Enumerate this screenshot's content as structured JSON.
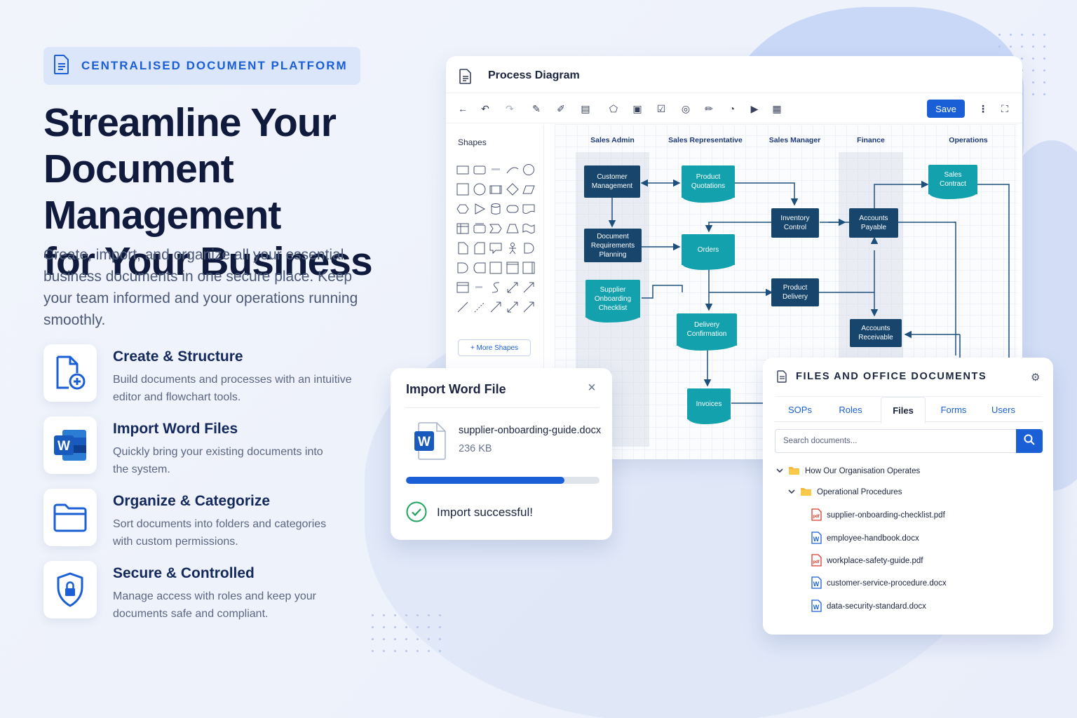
{
  "hero": {
    "badge": "CENTRALISED DOCUMENT PLATFORM",
    "headline_1": "Streamline Your",
    "headline_2": "Document Management",
    "headline_3": "for Your Business",
    "subtext": "Create, import, and organize all your essential business documents in one secure place. Keep your team informed and your operations running smoothly."
  },
  "features": [
    {
      "title": "Create & Structure",
      "desc": "Build documents and processes with an intuitive editor and flowchart tools.",
      "icon": "document-plus-icon"
    },
    {
      "title": "Import Word Files",
      "desc": "Quickly bring your existing documents into the system.",
      "icon": "word-icon"
    },
    {
      "title": "Organize & Categorize",
      "desc": "Sort documents into folders and categories with custom permissions.",
      "icon": "folder-icon"
    },
    {
      "title": "Secure & Controlled",
      "desc": "Manage access with roles and keep your documents safe and compliant.",
      "icon": "shield-lock-icon"
    }
  ],
  "diagram": {
    "title": "Process Diagram",
    "save_label": "Save",
    "shapes_title": "Shapes",
    "more_shapes": "+ More Shapes",
    "lanes": [
      "Sales Admin",
      "Sales Representative",
      "Sales Manager",
      "Finance",
      "Operations"
    ],
    "nodes": {
      "customer_management": "Customer Management",
      "product_quotations": "Product Quotations",
      "sales_contract": "Sales Contract",
      "inventory_control": "Inventory Control",
      "accounts_payable": "Accounts Payable",
      "document_requirements": "Document Requirements Planning",
      "orders": "Orders",
      "supplier_onboarding": "Supplier Onboarding Checklist",
      "product_delivery": "Product Delivery",
      "delivery_confirmation": "Delivery Confirmation",
      "accounts_receivable": "Accounts Receivable",
      "invoices": "Invoices"
    }
  },
  "import_dialog": {
    "title": "Import Word File",
    "file_name": "supplier-onboarding-guide.docx",
    "file_size": "236 KB",
    "progress": 0.82,
    "status": "Import successful!"
  },
  "files_panel": {
    "title": "FILES AND OFFICE DOCUMENTS",
    "tabs": [
      "SOPs",
      "Roles",
      "Files",
      "Forms",
      "Users"
    ],
    "active_tab": "Files",
    "search_placeholder": "Search documents...",
    "folder_1": "How Our Organisation Operates",
    "folder_2": "Operational Procedures",
    "files": [
      {
        "name": "supplier-onboarding-checklist.pdf",
        "type": "pdf"
      },
      {
        "name": "employee-handbook.docx",
        "type": "docx"
      },
      {
        "name": "workplace-safety-guide.pdf",
        "type": "pdf"
      },
      {
        "name": "customer-service-procedure.docx",
        "type": "docx"
      },
      {
        "name": "data-security-standard.docx",
        "type": "docx"
      }
    ]
  },
  "colors": {
    "accent": "#1a5fd6",
    "navy": "#0f1a3d",
    "node_dark": "#17456b",
    "node_teal": "#13a2ad"
  }
}
